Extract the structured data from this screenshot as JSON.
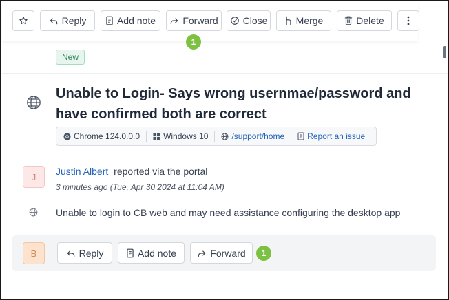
{
  "toolbar": {
    "star_icon": "star-icon",
    "reply_label": "Reply",
    "add_note_label": "Add note",
    "forward_label": "Forward",
    "forward_badge": "1",
    "close_label": "Close",
    "merge_label": "Merge",
    "delete_label": "Delete",
    "more_icon": "more-vertical-icon"
  },
  "ticket": {
    "status_tag": "New",
    "subject": "Unable to Login- Says wrong usernmae/password and have confirmed both are correct",
    "meta": {
      "browser": "Chrome 124.0.0.0",
      "os": "Windows 10",
      "page": "/support/home",
      "report": "Report an issue"
    }
  },
  "message": {
    "avatar_initial": "J",
    "author": "Justin Albert",
    "channel_text": "reported via the portal",
    "timestamp": "3 minutes ago (Tue, Apr 30 2024 at 11:04 AM)",
    "body": "Unable to login to CB web and may need assistance configuring the desktop app"
  },
  "reply_bar": {
    "avatar_initial": "B",
    "reply_label": "Reply",
    "add_note_label": "Add note",
    "forward_label": "Forward",
    "forward_badge": "1"
  },
  "colors": {
    "accent_blue": "#2563b8",
    "badge_green": "#7cc142",
    "tag_green_bg": "#e6f6ee"
  }
}
